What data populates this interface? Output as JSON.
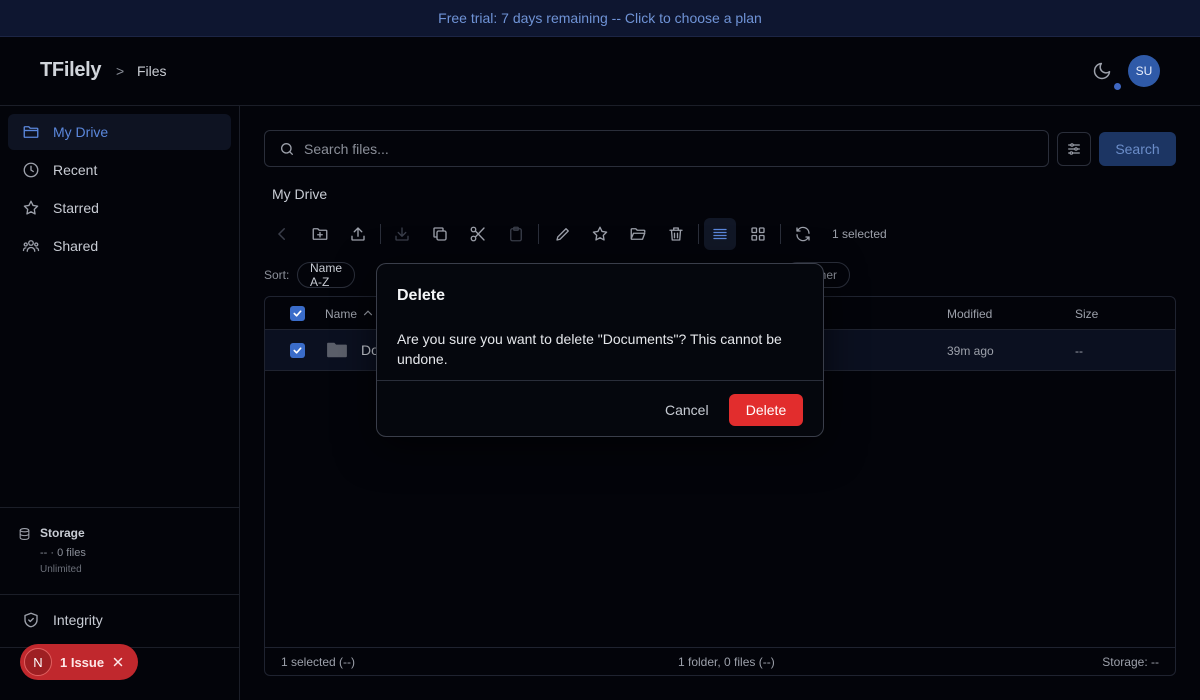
{
  "banner": {
    "text": "Free trial: 7 days remaining -- Click to choose a plan"
  },
  "header": {
    "logo": "TFilely",
    "separator": ">",
    "breadcrumb": "Files",
    "avatar_initials": "SU"
  },
  "sidebar": {
    "items": [
      {
        "label": "My Drive",
        "icon": "folder-icon",
        "active": true
      },
      {
        "label": "Recent",
        "icon": "clock-icon",
        "active": false
      },
      {
        "label": "Starred",
        "icon": "star-icon",
        "active": false
      },
      {
        "label": "Shared",
        "icon": "users-icon",
        "active": false
      }
    ],
    "storage": {
      "title": "Storage",
      "usage": "-- · 0 files",
      "limit": "Unlimited"
    },
    "integrity": "Integrity"
  },
  "main": {
    "search": {
      "placeholder": "Search files...",
      "button": "Search"
    },
    "section_title": "My Drive",
    "selected_count": "1 selected",
    "sort": {
      "label": "Sort:",
      "value": "Name A-Z",
      "partial_chip": "her"
    },
    "table": {
      "columns": {
        "name": "Name",
        "modified": "Modified",
        "size": "Size"
      },
      "rows": [
        {
          "name": "Do",
          "modified": "39m ago",
          "size": "--"
        }
      ],
      "footer": {
        "left": "1 selected (--)",
        "center": "1 folder, 0 files (--)",
        "right": "Storage: --"
      }
    }
  },
  "dialog": {
    "title": "Delete",
    "message": "Are you sure you want to delete \"Documents\"? This cannot be undone.",
    "cancel": "Cancel",
    "confirm": "Delete"
  },
  "issue_badge": {
    "letter": "N",
    "label": "1 Issue"
  },
  "colors": {
    "accent": "#3a6cc9",
    "danger": "#e22d2d",
    "background": "#03040a"
  }
}
